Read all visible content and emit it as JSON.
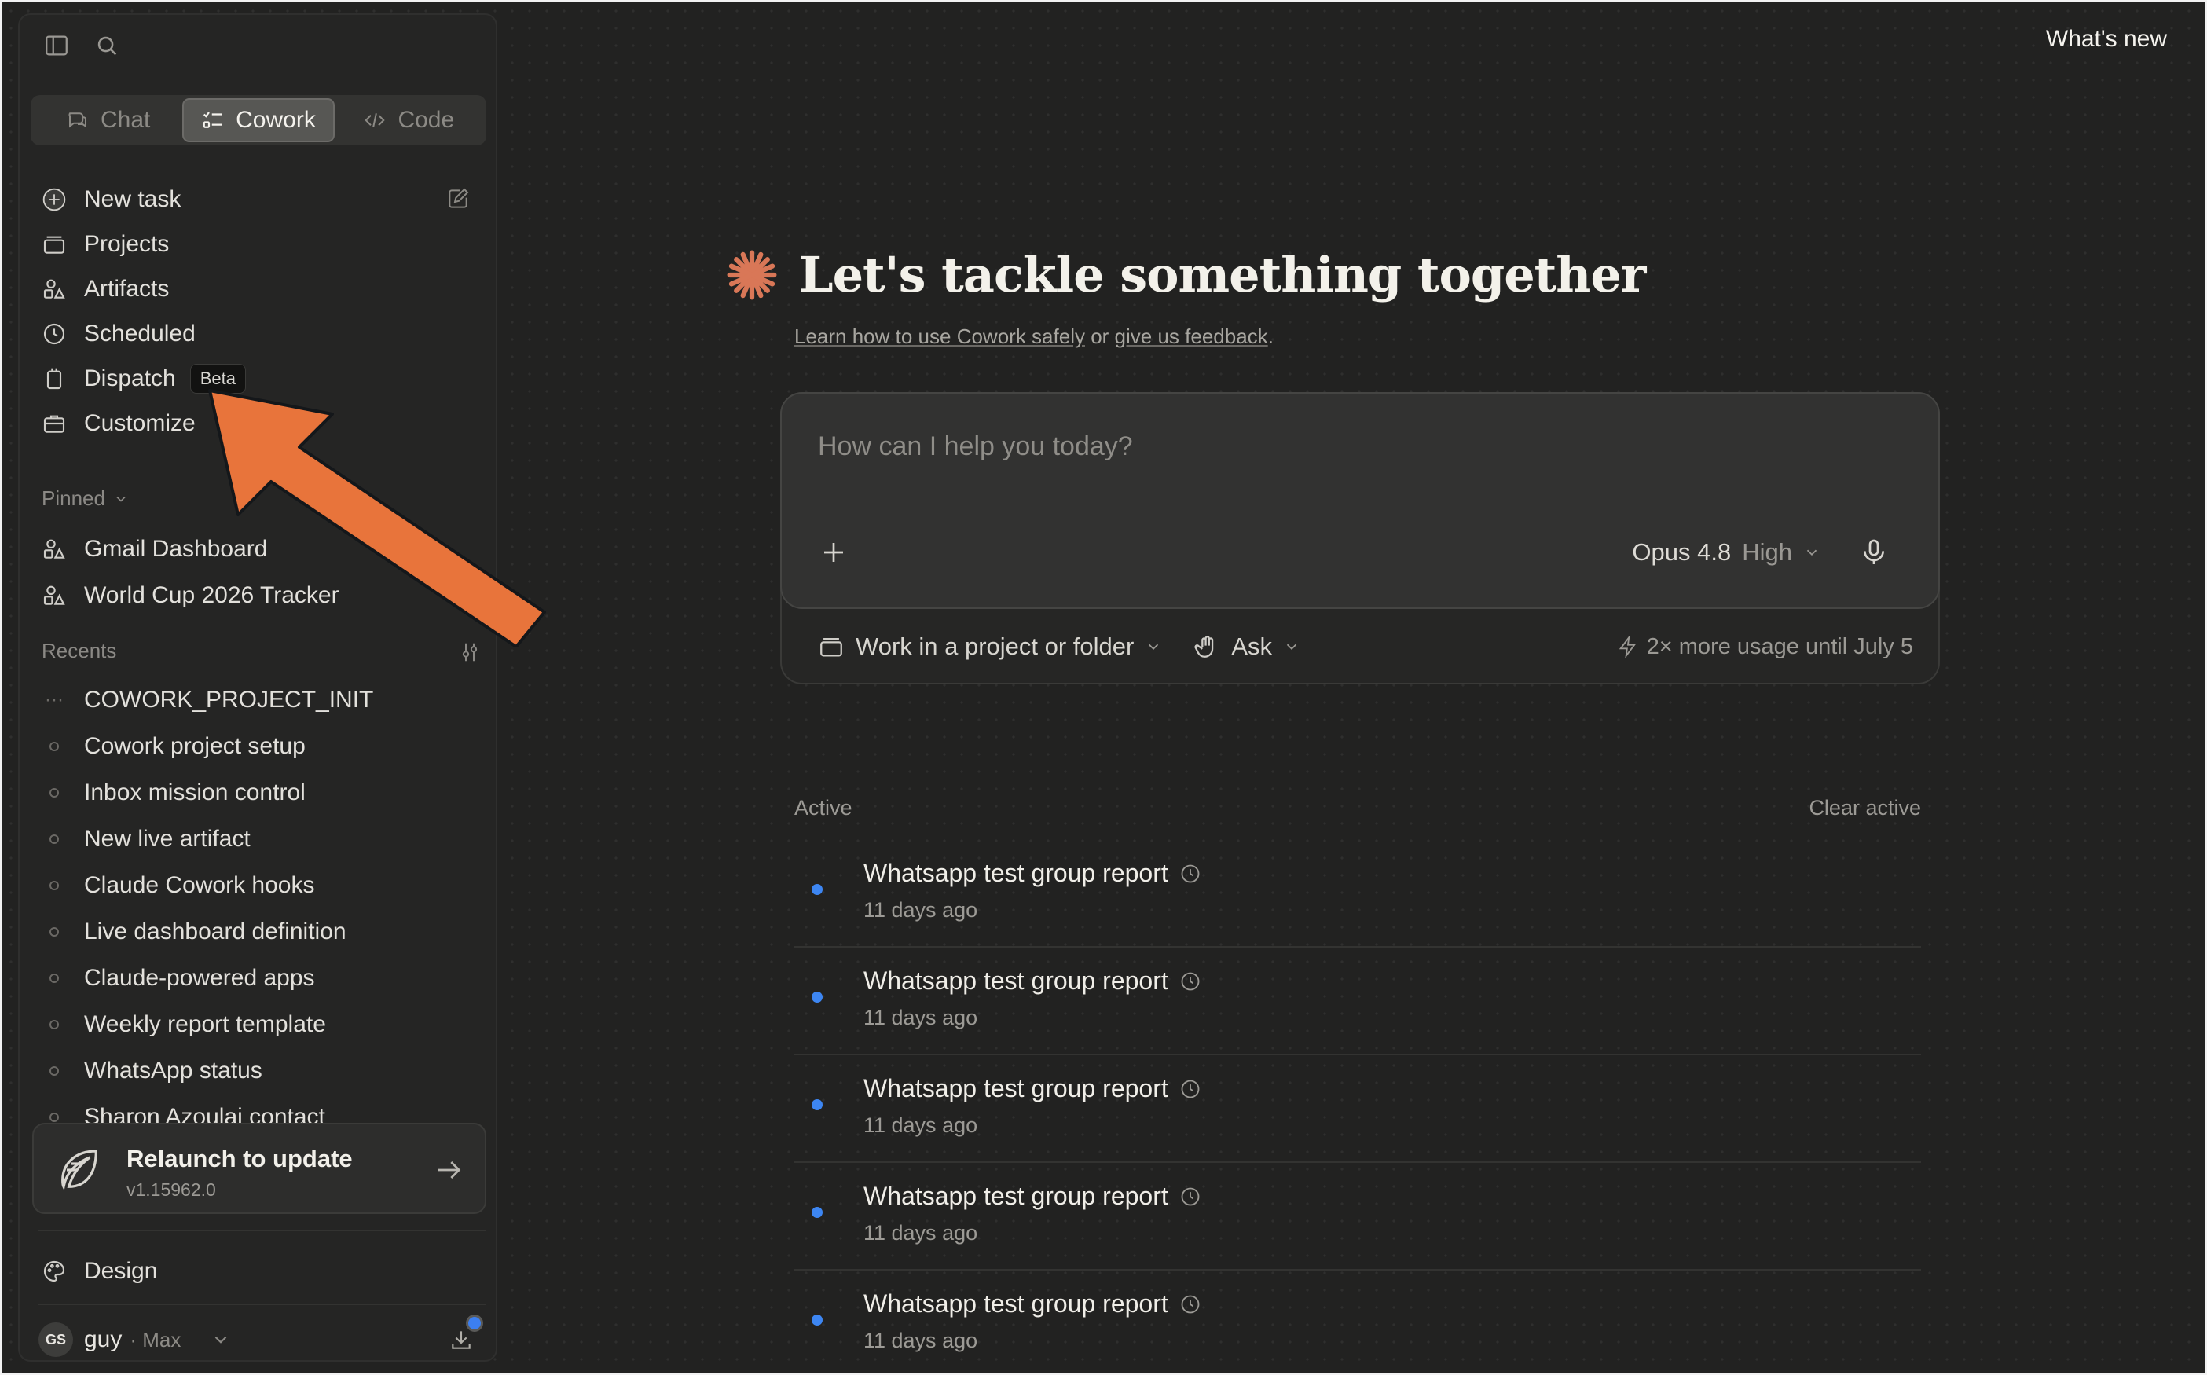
{
  "header": {
    "whats_new": "What's new"
  },
  "sidebar": {
    "tabs": [
      {
        "label": "Chat",
        "icon": "chat-icon",
        "active": false
      },
      {
        "label": "Cowork",
        "icon": "cowork-icon",
        "active": true
      },
      {
        "label": "Code",
        "icon": "code-icon",
        "active": false
      }
    ],
    "nav": [
      {
        "label": "New task",
        "icon": "plus-circle-icon"
      },
      {
        "label": "Projects",
        "icon": "projects-icon"
      },
      {
        "label": "Artifacts",
        "icon": "artifacts-icon"
      },
      {
        "label": "Scheduled",
        "icon": "clock-icon"
      },
      {
        "label": "Dispatch",
        "icon": "dispatch-icon",
        "badge": "Beta"
      },
      {
        "label": "Customize",
        "icon": "briefcase-icon"
      }
    ],
    "pinned_label": "Pinned",
    "pinned": [
      {
        "label": "Gmail Dashboard",
        "icon": "artifacts-icon"
      },
      {
        "label": "World Cup 2026 Tracker",
        "icon": "artifacts-icon"
      }
    ],
    "recents_label": "Recents",
    "recents": [
      {
        "label": "COWORK_PROJECT_INIT",
        "marker": "···"
      },
      {
        "label": "Cowork project setup"
      },
      {
        "label": "Inbox mission control"
      },
      {
        "label": "New live artifact"
      },
      {
        "label": "Claude Cowork hooks"
      },
      {
        "label": "Live dashboard definition"
      },
      {
        "label": "Claude-powered apps"
      },
      {
        "label": "Weekly report template"
      },
      {
        "label": "WhatsApp status"
      },
      {
        "label": "Sharon Azoulai contact"
      }
    ],
    "update": {
      "title": "Relaunch to update",
      "version": "v1.15962.0"
    },
    "design_label": "Design",
    "user": {
      "initials": "GS",
      "name": "guy",
      "plan": "· Max"
    }
  },
  "main": {
    "hero_title": "Let's tackle something together",
    "hero_link1": "Learn how to use Cowork safely",
    "hero_or": " or ",
    "hero_link2": "give us feedback",
    "hero_end": ".",
    "composer": {
      "placeholder": "How can I help you today?",
      "model": "Opus 4.8",
      "effort": "High"
    },
    "footer": {
      "project": "Work in a project or folder",
      "mode": "Ask",
      "usage": "2× more usage until July 5"
    },
    "active_label": "Active",
    "clear_active": "Clear active",
    "tasks": [
      {
        "title": "Whatsapp test group report",
        "time": "11 days ago"
      },
      {
        "title": "Whatsapp test group report",
        "time": "11 days ago"
      },
      {
        "title": "Whatsapp test group report",
        "time": "11 days ago"
      },
      {
        "title": "Whatsapp test group report",
        "time": "11 days ago"
      },
      {
        "title": "Whatsapp test group report",
        "time": "11 days ago"
      }
    ]
  },
  "colors": {
    "accent": "#d97757",
    "arrow": "#e8743b",
    "bullet": "#3d86f2"
  }
}
